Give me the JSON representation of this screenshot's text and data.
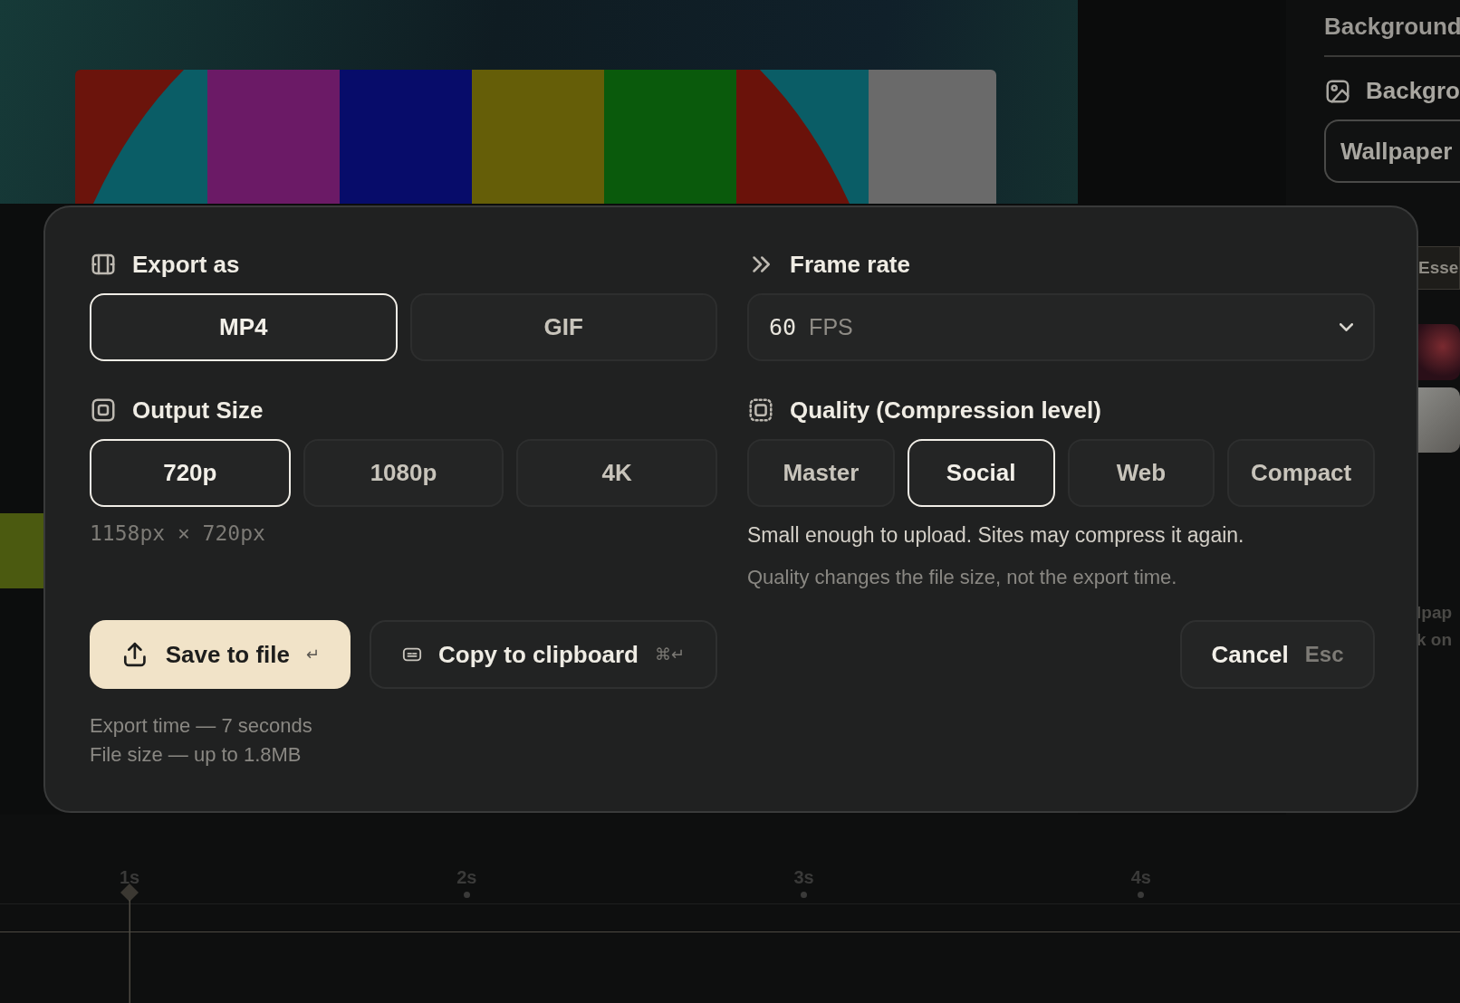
{
  "sidebar": {
    "heading": "Background",
    "section": "Backgro",
    "button": "Wallpaper",
    "tab_fragment": "Esse",
    "text_fragments": [
      "lpap",
      "k on"
    ]
  },
  "dialog": {
    "export_as": {
      "label": "Export as",
      "options": [
        {
          "label": "MP4",
          "selected": true
        },
        {
          "label": "GIF",
          "selected": false
        }
      ]
    },
    "frame_rate": {
      "label": "Frame rate",
      "value": "60",
      "unit": "FPS"
    },
    "output_size": {
      "label": "Output Size",
      "options": [
        {
          "label": "720p",
          "selected": true
        },
        {
          "label": "1080p",
          "selected": false
        },
        {
          "label": "4K",
          "selected": false
        }
      ],
      "dimensions": "1158px × 720px"
    },
    "quality": {
      "label": "Quality (Compression level)",
      "options": [
        {
          "label": "Master",
          "selected": false
        },
        {
          "label": "Social",
          "selected": true
        },
        {
          "label": "Web",
          "selected": false
        },
        {
          "label": "Compact",
          "selected": false
        }
      ],
      "description": "Small enough to upload. Sites may compress it again.",
      "note": "Quality changes the file size, not the export time."
    },
    "actions": [
      {
        "kind": "primary",
        "label": "Save to file",
        "shortcut": "↵"
      },
      {
        "kind": "secondary",
        "label": "Copy to clipboard",
        "shortcut": "⌘↵"
      }
    ],
    "cancel": {
      "label": "Cancel",
      "shortcut": "Esc"
    },
    "info": [
      "Export time — 7 seconds",
      "File size — up to 1.8MB"
    ]
  },
  "timeline": {
    "ticks": [
      "1s",
      "2s",
      "3s",
      "4s"
    ]
  }
}
